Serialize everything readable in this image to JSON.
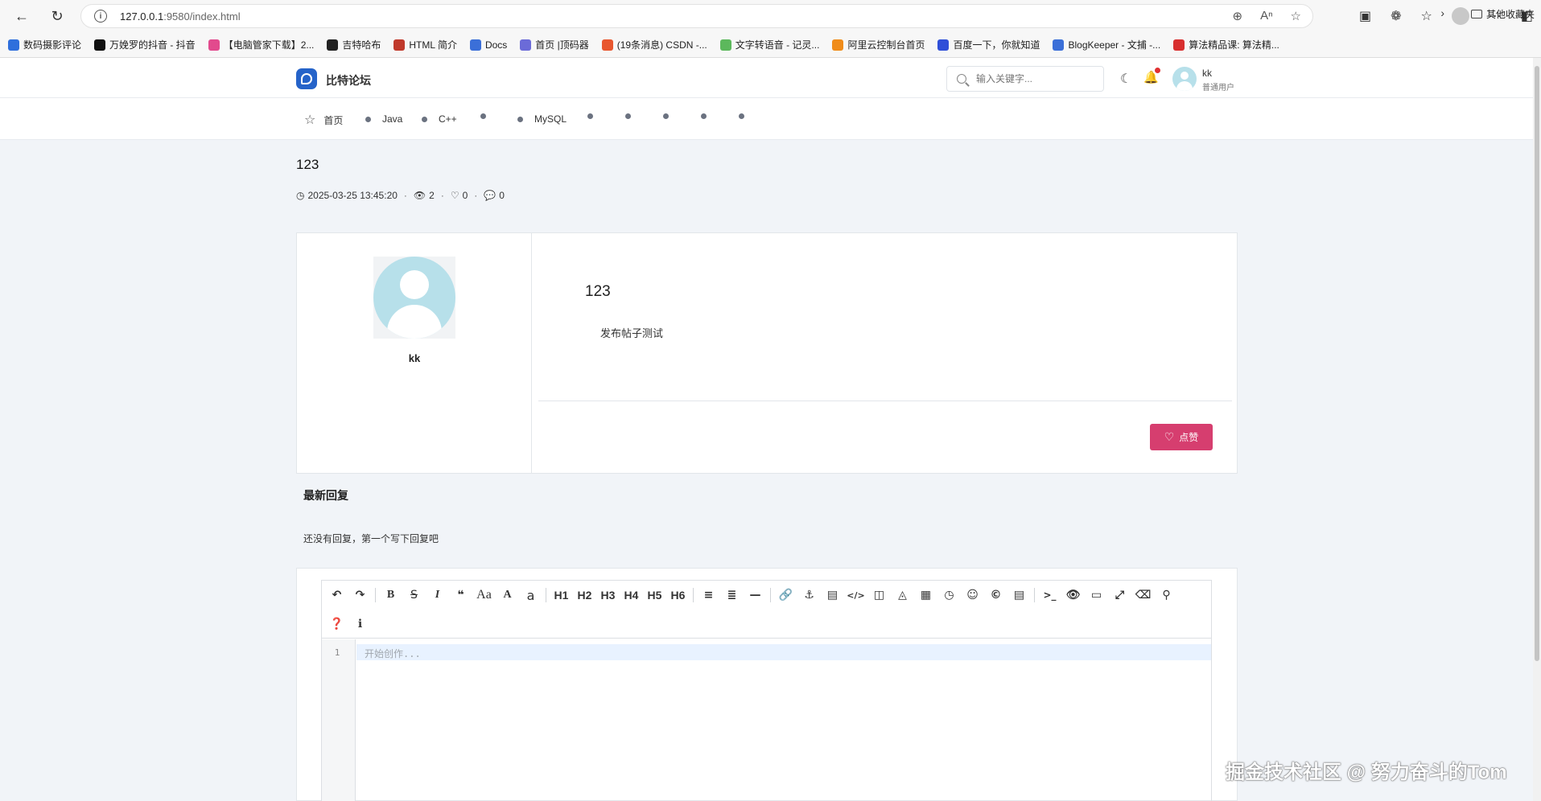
{
  "browser": {
    "url_host": "127.0.0.1",
    "url_path": ":9580/index.html",
    "bookmarks": [
      {
        "label": "数码摄影评论",
        "color": "#2f6fdc"
      },
      {
        "label": "万娩罗的抖音 - 抖音",
        "color": "#111111"
      },
      {
        "label": "【电脑管家下载】2...",
        "color": "#e24a8d"
      },
      {
        "label": "吉特哈布",
        "color": "#222222"
      },
      {
        "label": "HTML 简介",
        "color": "#c0392b"
      },
      {
        "label": "Docs",
        "color": "#3b6fd8"
      },
      {
        "label": "首页 |顶码器",
        "color": "#6b6bd8"
      },
      {
        "label": "(19条消息) CSDN -...",
        "color": "#e8572f"
      },
      {
        "label": "文字转语音 - 记灵...",
        "color": "#5cb85c"
      },
      {
        "label": "阿里云控制台首页",
        "color": "#f08c1a"
      },
      {
        "label": "百度一下，你就知道",
        "color": "#2f4fd8"
      },
      {
        "label": "BlogKeeper - 文捕 -...",
        "color": "#3b6fd8"
      },
      {
        "label": "算法精品课: 算法精...",
        "color": "#d82f2f"
      }
    ],
    "other_bookmarks": "其他收藏夹"
  },
  "header": {
    "brand": "比特论坛",
    "search_placeholder": "输入关键字...",
    "user_name": "kk",
    "user_role": "普通用户"
  },
  "nav": {
    "items": [
      "首页",
      "Java",
      "C++",
      "",
      "MySQL",
      "",
      "",
      "",
      "",
      ""
    ]
  },
  "post": {
    "title": "123",
    "timestamp": "2025-03-25 13:45:20",
    "views": "2",
    "likes": "0",
    "comments": "0",
    "author": "kk",
    "content_title": "123",
    "content_body": "发布帖子测试",
    "like_label": "点赞"
  },
  "replies": {
    "heading": "最新回复",
    "empty_text": "还没有回复，第一个写下回复吧"
  },
  "editor": {
    "headings": [
      "H1",
      "H2",
      "H3",
      "H4",
      "H5",
      "H6"
    ],
    "line_number": "1",
    "placeholder": "开始创作..."
  },
  "watermark": "掘金技术社区 @ 努力奋斗的Tom"
}
